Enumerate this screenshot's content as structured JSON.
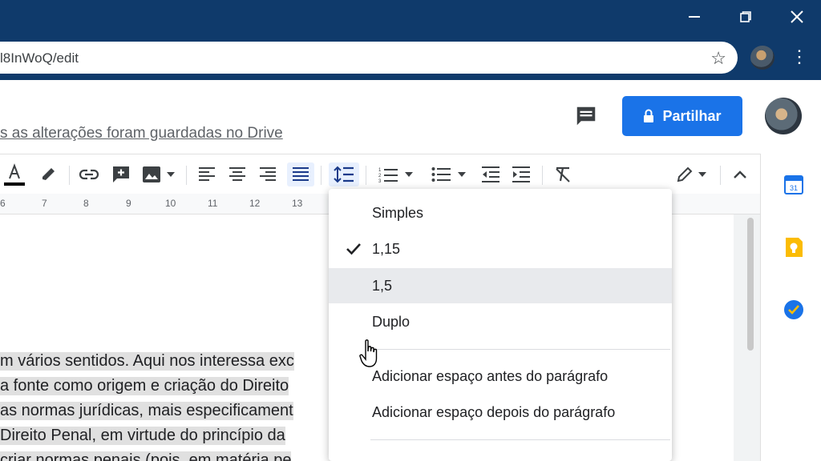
{
  "window": {
    "minimize_icon": "minimize-icon",
    "restore_icon": "restore-icon",
    "close_icon": "close-icon"
  },
  "browser": {
    "url": "l8InWoQ/edit"
  },
  "doc_header": {
    "saved_status": "s as alterações foram guardadas no Drive",
    "share_label": "Partilhar"
  },
  "ruler": {
    "ticks": [
      "6",
      "7",
      "8",
      "9",
      "10",
      "11",
      "12",
      "13"
    ]
  },
  "document": {
    "lines": [
      "m vários sentidos. Aqui nos interessa exc",
      "a fonte como origem e criação do Direito",
      "as normas jurídicas, mais especificament",
      "Direito Penal, em virtude do princípio da",
      "criar normas penais (pois, em matéria pe"
    ]
  },
  "line_spacing_menu": {
    "items": [
      {
        "label": "Simples",
        "checked": false
      },
      {
        "label": "1,15",
        "checked": true
      },
      {
        "label": "1,5",
        "checked": false
      },
      {
        "label": "Duplo",
        "checked": false
      }
    ],
    "space_before": "Adicionar espaço antes do parágrafo",
    "space_after": "Adicionar espaço depois do parágrafo"
  },
  "side_panel": {
    "calendar_day": "31"
  },
  "colors": {
    "titlebar": "#0f3a6b",
    "share_button": "#1a73e8",
    "menu_hover": "#e8eaed",
    "active_tool": "#e8f0fe"
  }
}
